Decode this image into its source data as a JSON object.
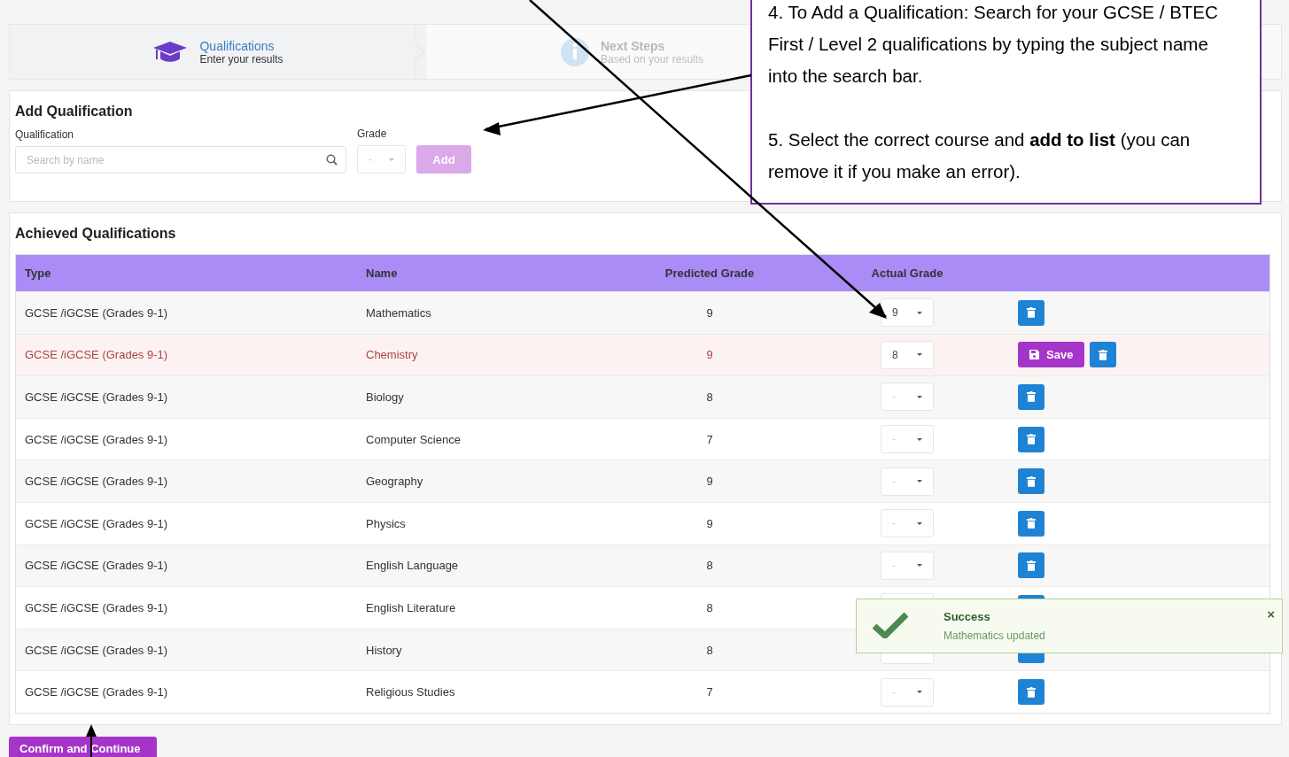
{
  "steps": [
    {
      "title": "Qualifications",
      "subtitle": "Enter your results",
      "selected": true
    },
    {
      "title": "Next Steps",
      "subtitle": "Based on your results",
      "selected": false
    }
  ],
  "add_form": {
    "title": "Add Qualification",
    "qualification_label": "Qualification",
    "search_placeholder": "Search by name",
    "grade_label": "Grade",
    "grade_placeholder": "-",
    "add_button": "Add",
    "add_disabled": true
  },
  "achieved": {
    "title": "Achieved Qualifications",
    "columns": [
      "Type",
      "Name",
      "Predicted Grade",
      "Actual Grade"
    ],
    "rows": [
      {
        "type": "GCSE /iGCSE (Grades 9-1)",
        "name": "Mathematics",
        "predicted": "9",
        "actual": {
          "value": "9"
        },
        "unsaved": false
      },
      {
        "type": "GCSE /iGCSE (Grades 9-1)",
        "name": "Chemistry",
        "predicted": "9",
        "actual": {
          "value": "8"
        },
        "unsaved": true,
        "save_label": "Save"
      },
      {
        "type": "GCSE /iGCSE (Grades 9-1)",
        "name": "Biology",
        "predicted": "8",
        "actual": {
          "placeholder": "-"
        },
        "unsaved": false
      },
      {
        "type": "GCSE /iGCSE (Grades 9-1)",
        "name": "Computer Science",
        "predicted": "7",
        "actual": {
          "placeholder": "-"
        },
        "unsaved": false
      },
      {
        "type": "GCSE /iGCSE (Grades 9-1)",
        "name": "Geography",
        "predicted": "9",
        "actual": {
          "placeholder": "-"
        },
        "unsaved": false
      },
      {
        "type": "GCSE /iGCSE (Grades 9-1)",
        "name": "Physics",
        "predicted": "9",
        "actual": {
          "placeholder": "-"
        },
        "unsaved": false
      },
      {
        "type": "GCSE /iGCSE (Grades 9-1)",
        "name": "English Language",
        "predicted": "8",
        "actual": {
          "placeholder": "-"
        },
        "unsaved": false
      },
      {
        "type": "GCSE /iGCSE (Grades 9-1)",
        "name": "English Literature",
        "predicted": "8",
        "actual": {},
        "unsaved": false
      },
      {
        "type": "GCSE /iGCSE (Grades 9-1)",
        "name": "History",
        "predicted": "8",
        "actual": {},
        "unsaved": false
      },
      {
        "type": "GCSE /iGCSE (Grades 9-1)",
        "name": "Religious Studies",
        "predicted": "7",
        "actual": {
          "placeholder": "-"
        },
        "unsaved": false
      }
    ]
  },
  "confirm_button": "Confirm and Continue",
  "toast": {
    "title": "Success",
    "message": "Mathematics updated",
    "close": "×"
  },
  "callout": {
    "lines": [
      "4. To Add a Qualification: Search for your GCSE / BTEC First / Level 2 qualifications by typing the subject name into the search bar.",
      "5. Select the correct course and **add to list** (you can remove it if you make an error)."
    ]
  }
}
